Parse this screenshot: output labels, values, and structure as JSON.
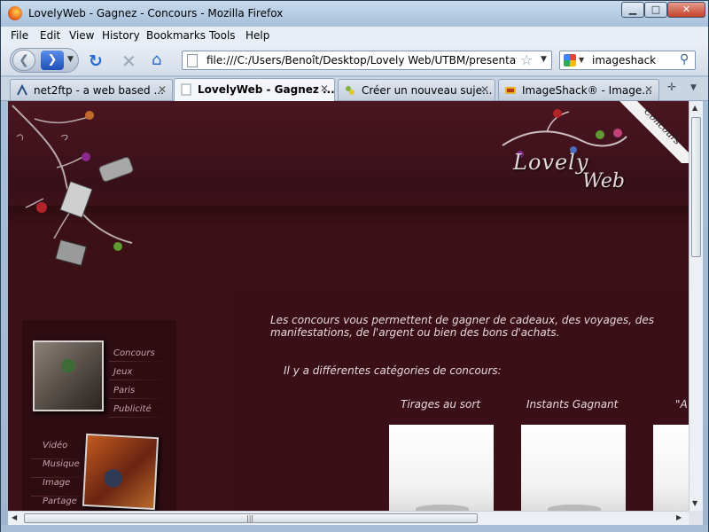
{
  "window": {
    "title": "LovelyWeb - Gagnez - Concours - Mozilla Firefox",
    "min_label": "▁",
    "max_label": "□",
    "close_label": "✕"
  },
  "menu": {
    "file": "File",
    "edit": "Edit",
    "view": "View",
    "history": "History",
    "bookmarks": "Bookmarks",
    "tools": "Tools",
    "help": "Help"
  },
  "nav": {
    "url": "file:///C:/Users/Benoît/Desktop/Lovely Web/UTBM/presentation.h",
    "search_value": "imageshack"
  },
  "tabs": [
    {
      "label": "net2ftp - a web based ...",
      "active": false
    },
    {
      "label": "LovelyWeb - Gagnez ...",
      "active": true
    },
    {
      "label": "Créer un nouveau suje...",
      "active": false
    },
    {
      "label": "ImageShack® - Image...",
      "active": false
    }
  ],
  "site": {
    "ribbon": "Concours",
    "logo_line1": "Lovely",
    "logo_line2": "Web",
    "sidebar_top": [
      "Concours",
      "Jeux",
      "Paris",
      "Publicité"
    ],
    "sidebar_bottom": [
      "Vidéo",
      "Musique",
      "Image",
      "Partage"
    ],
    "intro_line1": "Les concours vous permettent de gagner de cadeaux, des voyages, des",
    "intro_line2": "manifestations, de l'argent ou bien des bons d'achats.",
    "categories_title": "Il y a différentes catégories de concours:",
    "columns": [
      "Tirages au sort",
      "Instants Gagnant",
      "\"A"
    ]
  },
  "colors": {
    "page_bg": "#3b1017",
    "accent_text": "#e6d9dc",
    "sidebar_text": "#c9a3ac"
  }
}
